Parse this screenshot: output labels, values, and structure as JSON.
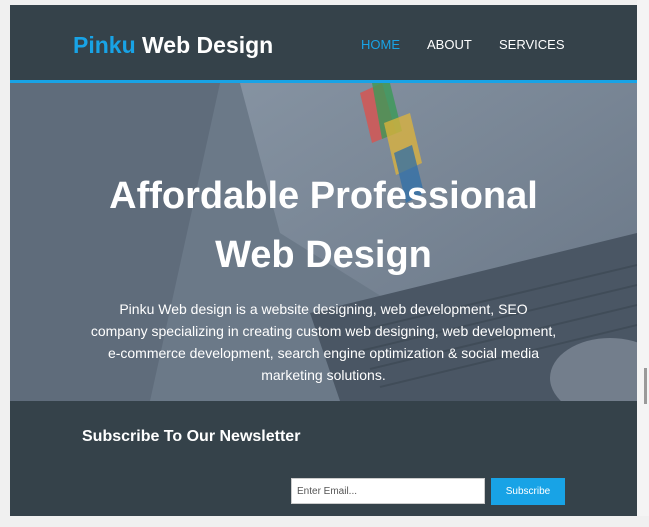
{
  "header": {
    "logo_highlight": "Pinku",
    "logo_rest": " Web Design",
    "nav": [
      {
        "label": "HOME",
        "active": true
      },
      {
        "label": "ABOUT",
        "active": false
      },
      {
        "label": "SERVICES",
        "active": false
      }
    ]
  },
  "hero": {
    "title_line1": "Affordable Professional",
    "title_line2": "Web Design",
    "description_lines": [
      "Pinku Web design is a website designing, web development, SEO",
      "company specializing in creating custom web designing, web development,",
      "e-commerce development, search engine optimization & social media",
      "marketing solutions."
    ]
  },
  "newsletter": {
    "heading": "Subscribe To Our Newsletter",
    "email_placeholder": "Enter Email...",
    "email_value": "",
    "subscribe_label": "Subscribe"
  },
  "colors": {
    "accent": "#18a3e6",
    "header_bg": "#35424a",
    "text": "#ffffff"
  }
}
